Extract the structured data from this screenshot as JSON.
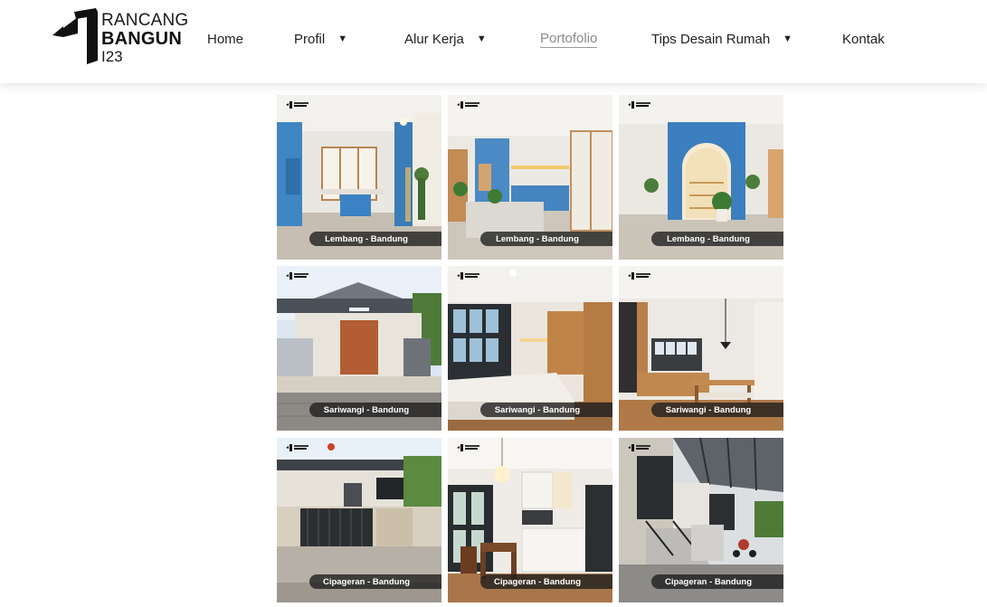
{
  "brand": {
    "line1": "RANCANG",
    "line2": "BANGUN",
    "line3": "I23",
    "logo_icon": "rancang-bangun-logo-mark"
  },
  "nav": {
    "items": [
      {
        "label": "Home",
        "dropdown": false,
        "active": false
      },
      {
        "label": "Profil",
        "dropdown": true,
        "active": false
      },
      {
        "label": "Alur Kerja",
        "dropdown": true,
        "active": false
      },
      {
        "label": "Portofolio",
        "dropdown": false,
        "active": true
      },
      {
        "label": "Tips Desain Rumah",
        "dropdown": true,
        "active": false
      },
      {
        "label": "Kontak",
        "dropdown": false,
        "active": false
      }
    ],
    "caret_glyph": "▼"
  },
  "gallery": {
    "tiles": [
      {
        "caption": "Lembang - Bandung",
        "scene": "blue-kitchen-window"
      },
      {
        "caption": "Lembang - Bandung",
        "scene": "blue-cabinet-kitchen"
      },
      {
        "caption": "Lembang - Bandung",
        "scene": "blue-arch-shelf"
      },
      {
        "caption": "Sariwangi - Bandung",
        "scene": "house-facade-carport"
      },
      {
        "caption": "Sariwangi - Bandung",
        "scene": "bedroom"
      },
      {
        "caption": "Sariwangi - Bandung",
        "scene": "kitchen-dining"
      },
      {
        "caption": "Cipageran - Bandung",
        "scene": "house-front-gate"
      },
      {
        "caption": "Cipageran - Bandung",
        "scene": "kitchen-dining-chandelier"
      },
      {
        "caption": "Cipageran - Bandung",
        "scene": "terrace-stairs"
      }
    ]
  },
  "colors": {
    "accent_blue": "#3f7fb8",
    "wood": "#b57a45",
    "caption_bg": "#1c1c1c"
  }
}
